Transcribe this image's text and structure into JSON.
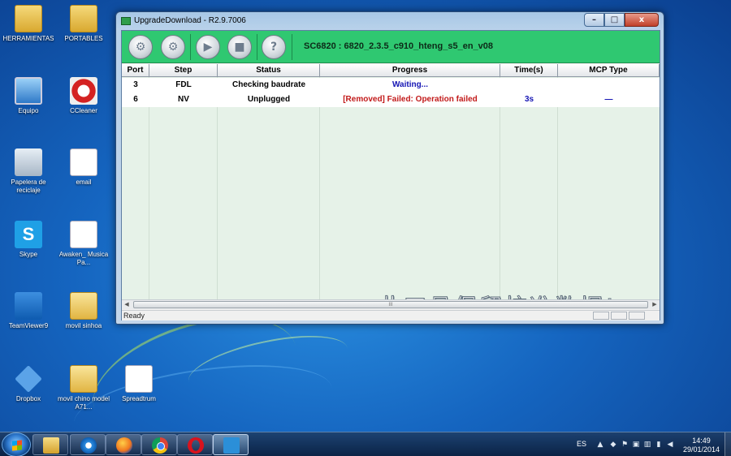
{
  "desktop": {
    "icons": [
      {
        "label": "HERRAMIENTAS",
        "icon": "folder-icon"
      },
      {
        "label": "PORTABLES",
        "icon": "folder-icon"
      },
      {
        "label": "Equipo",
        "icon": "computer-icon"
      },
      {
        "label": "CCleaner",
        "icon": "ccleaner-icon"
      },
      {
        "label": "Papelera de reciclaje",
        "icon": "recycle-bin-icon"
      },
      {
        "label": "email",
        "icon": "document-icon"
      },
      {
        "label": "Skype",
        "icon": "skype-icon"
      },
      {
        "label": "Awaken_ Musica Pa...",
        "icon": "media-file-icon"
      },
      {
        "label": "TeamViewer9",
        "icon": "teamviewer-icon"
      },
      {
        "label": "movil sinhoa",
        "icon": "folder-icon"
      },
      {
        "label": "Dropbox",
        "icon": "dropbox-icon"
      },
      {
        "label": "movil chino model A71...",
        "icon": "folder-icon"
      },
      {
        "label": "Spreadtrum",
        "icon": "document-icon"
      }
    ]
  },
  "window": {
    "title": "UpgradeDownload - R2.9.7006",
    "controls": {
      "minimize": "–",
      "maximize": "□",
      "close": "x"
    },
    "toolbar": {
      "buttons": [
        {
          "name": "settings",
          "icon": "gear-icon",
          "glyph": "⚙"
        },
        {
          "name": "options",
          "icon": "gears-icon",
          "glyph": "⚙"
        },
        {
          "name": "start",
          "icon": "play-icon",
          "glyph": "▶"
        },
        {
          "name": "stop",
          "icon": "stop-icon",
          "glyph": "■"
        },
        {
          "name": "help",
          "icon": "help-icon",
          "glyph": "?"
        }
      ],
      "firmware": "SC6820 : 6820_2.3.5_c910_hteng_s5_en_v08"
    },
    "table": {
      "columns": [
        "Port",
        "Step",
        "Status",
        "Progress",
        "Time(s)",
        "MCP Type"
      ],
      "rows": [
        {
          "port": "3",
          "step": "FDL",
          "status": "Checking baudrate",
          "progress": "Waiting...",
          "time": "",
          "mcp": ""
        },
        {
          "port": "6",
          "step": "NV",
          "status": "Unplugged",
          "progress": "[Removed] Failed: Operation failed",
          "time": "3s",
          "mcp": "—"
        }
      ]
    },
    "watermark": "此工具保留校准数据!",
    "scrollbar": {
      "left": "◀",
      "right": "▶",
      "grip": "III"
    },
    "status": "Ready"
  },
  "taskbar": {
    "apps": [
      {
        "name": "explorer",
        "icon": "folder-icon"
      },
      {
        "name": "internet-explorer",
        "icon": "ie-icon"
      },
      {
        "name": "firefox",
        "icon": "firefox-icon"
      },
      {
        "name": "chrome",
        "icon": "chrome-icon"
      },
      {
        "name": "opera",
        "icon": "opera-icon"
      },
      {
        "name": "upgrade-download",
        "icon": "upgrade-download-icon",
        "active": true
      }
    ],
    "tray": {
      "language": "ES",
      "time": "14:49",
      "date": "29/01/2014"
    }
  },
  "colors": {
    "toolbar": "#2fc871",
    "grid": "#e6f2e8",
    "waiting": "#1515b4",
    "failed": "#c21a1a"
  }
}
